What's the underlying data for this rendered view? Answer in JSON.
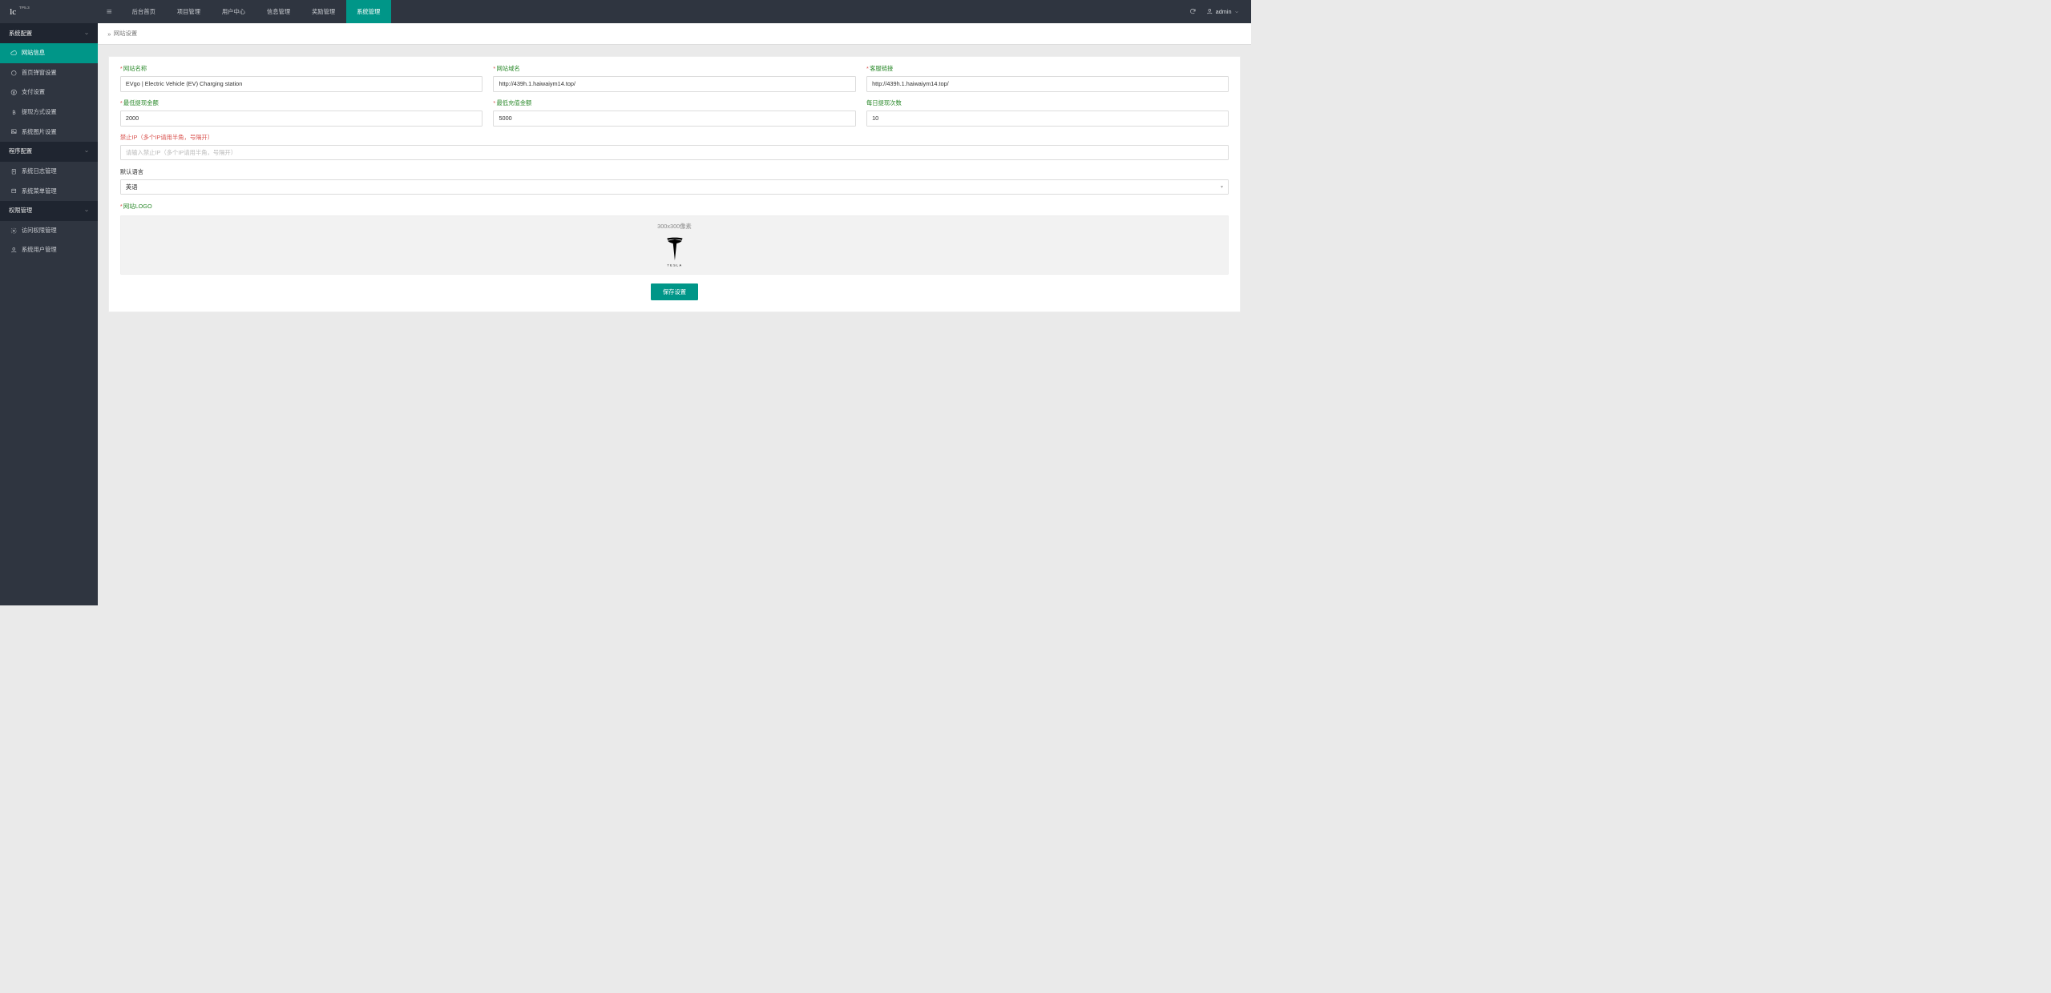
{
  "brand": {
    "name": "lc",
    "version": "TP5.3"
  },
  "topnav": {
    "items": [
      "后台首页",
      "项目管理",
      "用户中心",
      "信息管理",
      "奖励管理",
      "系统管理"
    ],
    "active_index": 5
  },
  "user": {
    "name": "admin"
  },
  "sidebar": {
    "groups": [
      {
        "title": "系统配置",
        "items": [
          "网站信息",
          "首页弹窗设置",
          "支付设置",
          "提现方式设置",
          "系统图片设置"
        ],
        "active_index": 0
      },
      {
        "title": "程序配置",
        "items": [
          "系统日志管理",
          "系统菜单管理"
        ],
        "active_index": -1
      },
      {
        "title": "权限管理",
        "items": [
          "访问权限管理",
          "系统用户管理"
        ],
        "active_index": -1
      }
    ]
  },
  "breadcrumb": {
    "sep": "»",
    "current": "网站设置"
  },
  "form": {
    "site_name": {
      "label": "网站名称",
      "value": "EVgo | Electric Vehicle (EV) Charging station",
      "required": true
    },
    "site_domain": {
      "label": "网站域名",
      "value": "http://439h.1.haiwaiym14.top/",
      "required": true
    },
    "cs_link": {
      "label": "客服链接",
      "value": "http://439h.1.haiwaiym14.top/",
      "required": true
    },
    "min_withdraw": {
      "label": "最低提现金额",
      "value": "2000",
      "required": true
    },
    "min_deposit": {
      "label": "最低充值金额",
      "value": "5000",
      "required": true
    },
    "daily_withdraw": {
      "label": "每日提现次数",
      "value": "10",
      "required": false
    },
    "ban_ip": {
      "label": "禁止IP",
      "hint": "（多个IP请用半角，号隔开）",
      "placeholder": "请输入禁止IP（多个IP请用半角，号隔开）",
      "value": ""
    },
    "lang": {
      "label": "默认语言",
      "value": "英语"
    },
    "logo": {
      "label": "网站LOGO",
      "hint": "300x300像素",
      "alt": "TESLA"
    },
    "save": "保存设置"
  }
}
